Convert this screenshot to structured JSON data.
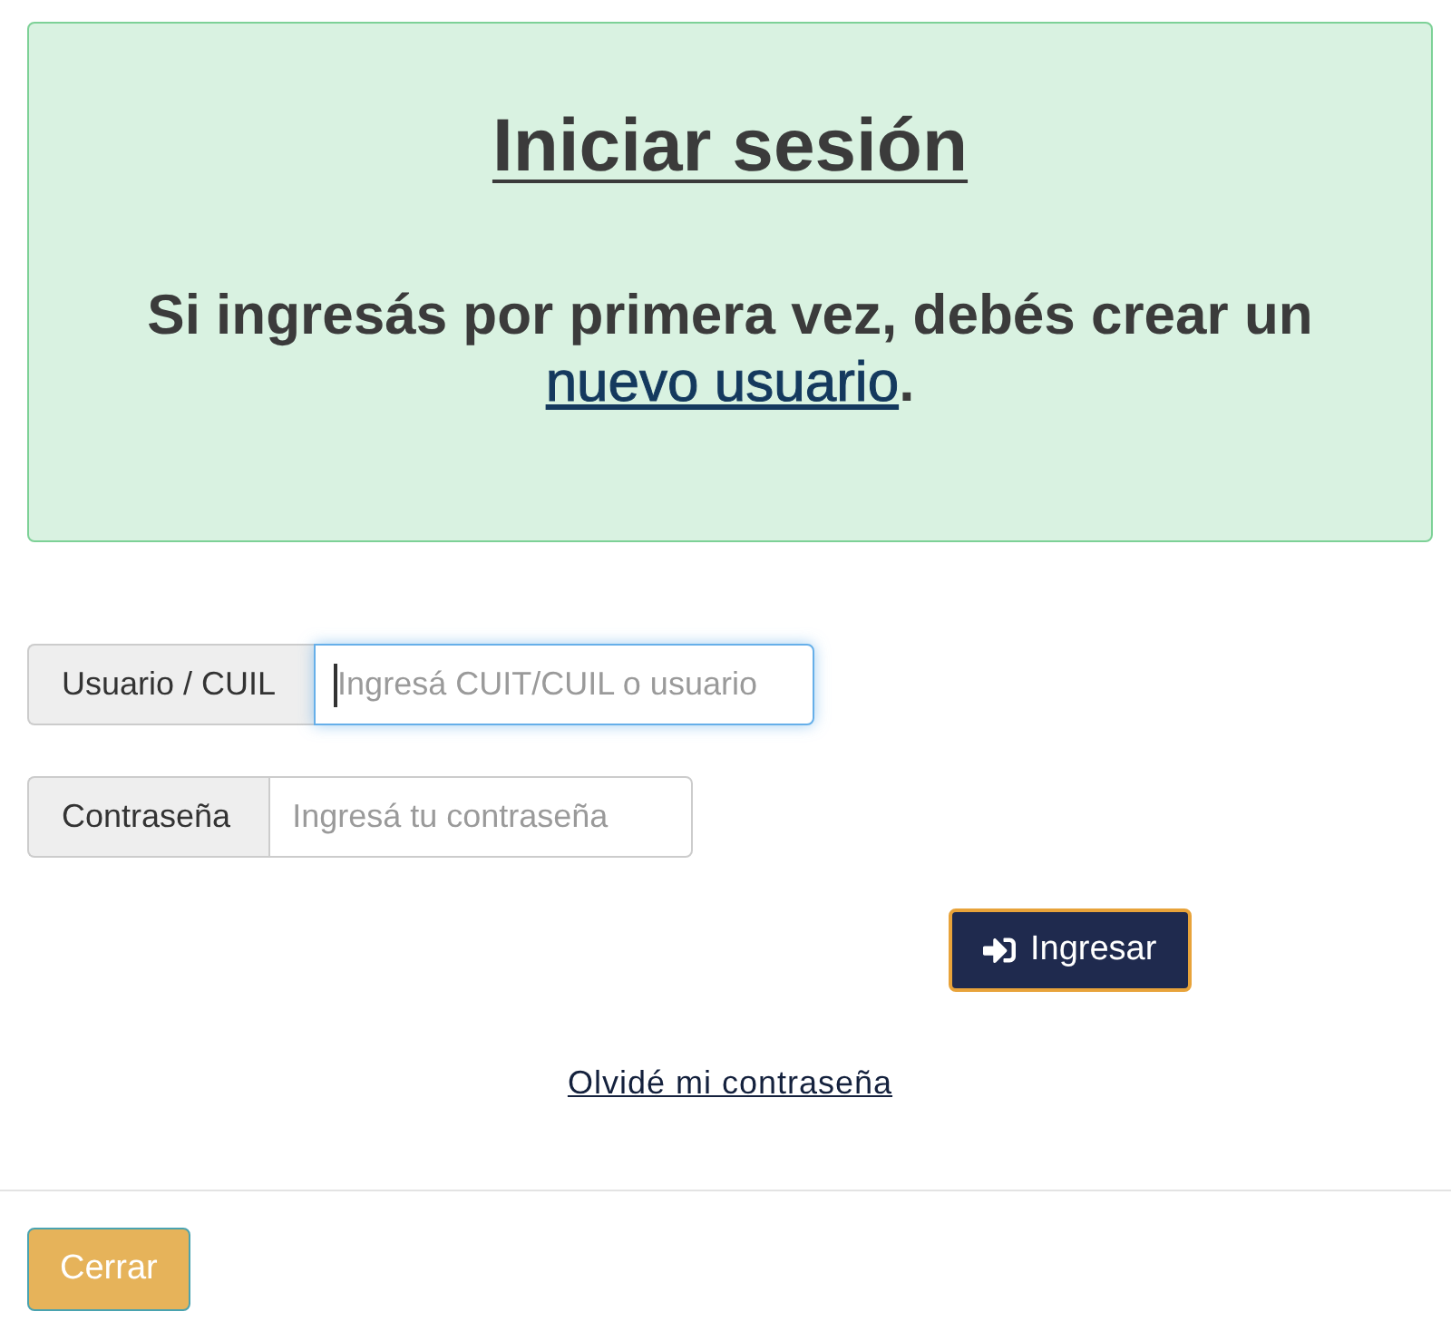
{
  "login_panel": {
    "title": "Iniciar sesión",
    "message_before": "Si ingresás por primera vez, debés crear un ",
    "message_link": "nuevo usuario",
    "message_after": "."
  },
  "fields": [
    {
      "label": "Usuario / CUIL",
      "placeholder": "Ingresá CUIT/CUIL o usuario",
      "focused": true
    },
    {
      "label": "Contraseña",
      "placeholder": "Ingresá tu contraseña",
      "focused": false
    }
  ],
  "submit_button": {
    "label": "Ingresar"
  },
  "forgot_password_link": "Olvidé mi contraseña",
  "footer": {
    "close_button": "Cerrar"
  }
}
